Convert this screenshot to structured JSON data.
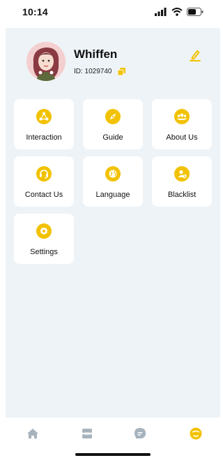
{
  "status": {
    "time": "10:14"
  },
  "profile": {
    "name": "Whiffen",
    "id_text": "ID: 1029740"
  },
  "menu": [
    {
      "label": "Interaction",
      "icon": "interaction-icon"
    },
    {
      "label": "Guide",
      "icon": "compass-icon"
    },
    {
      "label": "About Us",
      "icon": "group-icon"
    },
    {
      "label": "Contact Us",
      "icon": "headset-icon"
    },
    {
      "label": "Language",
      "icon": "globe-icon"
    },
    {
      "label": "Blacklist",
      "icon": "blocked-user-icon"
    },
    {
      "label": "Settings",
      "icon": "gear-icon"
    }
  ],
  "tabs": [
    {
      "name": "home",
      "icon": "home-icon",
      "active": false
    },
    {
      "name": "discover",
      "icon": "inbox-icon",
      "active": false
    },
    {
      "name": "messages",
      "icon": "chat-icon",
      "active": false
    },
    {
      "name": "profile",
      "icon": "face-icon",
      "active": true
    }
  ],
  "colors": {
    "accent": "#f2c200",
    "background": "#eef3f7",
    "card": "#ffffff",
    "inactive_tab": "#a7b3bd"
  }
}
